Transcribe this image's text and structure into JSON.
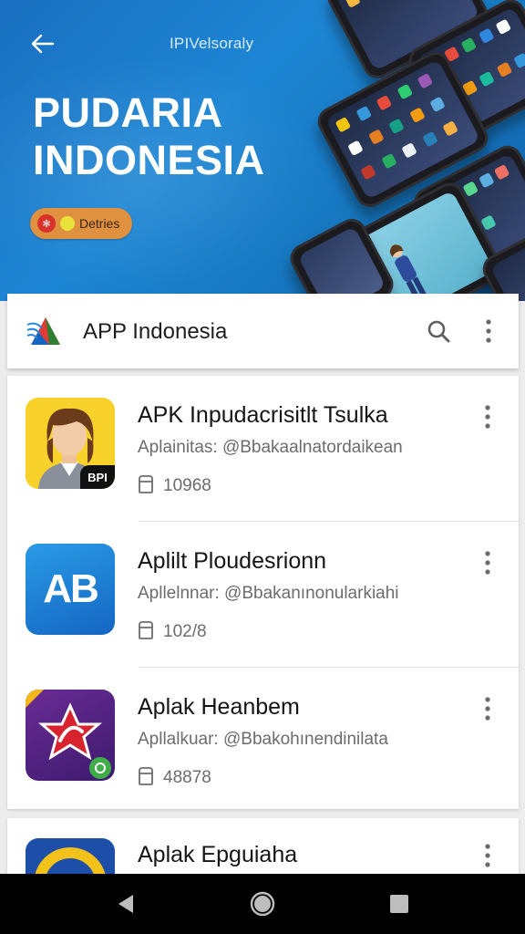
{
  "hero": {
    "small_text": "IPIVelsoraly",
    "title_line1": "PUDARIA",
    "title_line2": "INDONESIA",
    "badge_text": "Detries"
  },
  "header": {
    "title": "APP Indonesia"
  },
  "apps": [
    {
      "title": "APK Inpudacrisitlt Tsulka",
      "subtitle": "Aplainitas: @Bbakaalnatordaikean",
      "size": "10968",
      "icon": "avatar-app-icon",
      "icon_badge": "ВРІ"
    },
    {
      "title": "Aplilt Ploudesrionn",
      "subtitle": "Apllelnnar: @Bbakanınonularkiahi",
      "size": "102/8",
      "icon": "ab-app-icon",
      "icon_text": "AB"
    },
    {
      "title": "Aplak Heanbem",
      "subtitle": "Apllalkuar: @Bbakohınendinilata",
      "size": "48878",
      "icon": "star-app-icon"
    },
    {
      "title": "Aplak Epguiaha",
      "icon": "circle-app-icon"
    }
  ],
  "colors": {
    "hero_blue": "#1a7ccc",
    "badge_orange": "#e0913f",
    "ab_blue": "#1f86d9",
    "star_purple": "#5b2a8c",
    "star_red": "#d8222e"
  }
}
